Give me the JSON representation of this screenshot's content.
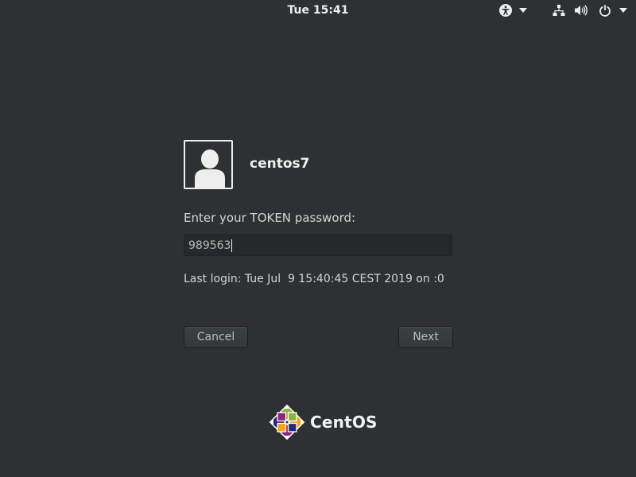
{
  "topbar": {
    "clock": "Tue 15:41",
    "icons": [
      "accessibility-icon",
      "chevron-down-icon",
      "network-icon",
      "volume-icon",
      "power-icon",
      "chevron-down-icon"
    ]
  },
  "login": {
    "username": "centos7",
    "prompt": "Enter your TOKEN password:",
    "password_value": "989563",
    "last_login": "Last login: Tue Jul  9 15:40:45 CEST 2019 on :0",
    "cancel_label": "Cancel",
    "next_label": "Next"
  },
  "branding": {
    "logo_text": "CentOS"
  },
  "colors": {
    "background": "#2d3133",
    "text": "#eeeeec",
    "field": "#25292a",
    "logo_green": "#8bb53c",
    "logo_orange": "#f2a21b",
    "logo_purple": "#932279",
    "logo_blue": "#262577"
  }
}
